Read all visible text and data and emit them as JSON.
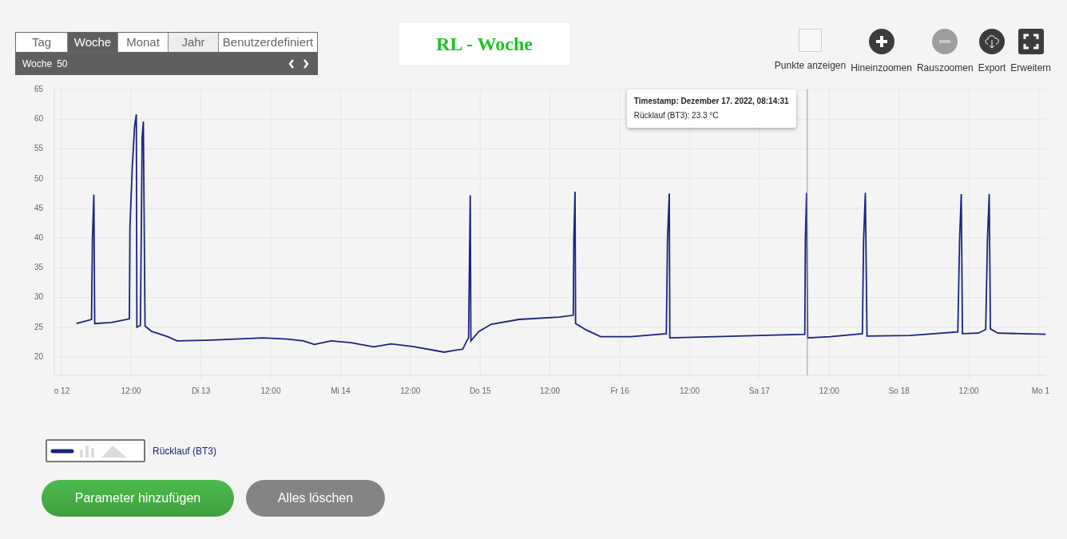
{
  "range_tabs": [
    {
      "label": "Tag",
      "selected": false,
      "hovered": false
    },
    {
      "label": "Woche",
      "selected": true,
      "hovered": false
    },
    {
      "label": "Monat",
      "selected": false,
      "hovered": false
    },
    {
      "label": "Jahr",
      "selected": false,
      "hovered": true
    },
    {
      "label": "Benutzerdefiniert",
      "selected": false,
      "hovered": false
    }
  ],
  "period": {
    "label": "Woche",
    "number": "50"
  },
  "title": "RL - Woche",
  "toolbar": [
    {
      "kind": "checkbox",
      "label": "Punkte anzeigen",
      "checked": false,
      "disabled": false
    },
    {
      "kind": "zoom_in",
      "label": "Hineinzoomen",
      "disabled": false
    },
    {
      "kind": "zoom_out",
      "label": "Rauszoomen",
      "disabled": true
    },
    {
      "kind": "export",
      "label": "Export",
      "disabled": false
    },
    {
      "kind": "expand",
      "label": "Erweitern",
      "disabled": false
    }
  ],
  "chart": {
    "chart_data": {
      "type": "line",
      "grid": true,
      "xlim": [
        "2022-12-11T22:48",
        "2022-12-19T01:18"
      ],
      "ylim": [
        16.9,
        65
      ],
      "xticks": [
        {
          "value": "2022-12-12T00:00",
          "label": "o 12"
        },
        {
          "value": "2022-12-12T12:00",
          "label": "12:00"
        },
        {
          "value": "2022-12-13T00:00",
          "label": "Di 13"
        },
        {
          "value": "2022-12-13T12:00",
          "label": "12:00"
        },
        {
          "value": "2022-12-14T00:00",
          "label": "Mi 14"
        },
        {
          "value": "2022-12-14T12:00",
          "label": "12:00"
        },
        {
          "value": "2022-12-15T00:00",
          "label": "Do 15"
        },
        {
          "value": "2022-12-15T12:00",
          "label": "12:00"
        },
        {
          "value": "2022-12-16T00:00",
          "label": "Fr 16"
        },
        {
          "value": "2022-12-16T12:00",
          "label": "12:00"
        },
        {
          "value": "2022-12-17T00:00",
          "label": "Sa 17"
        },
        {
          "value": "2022-12-17T12:00",
          "label": "12:00"
        },
        {
          "value": "2022-12-18T00:00",
          "label": "So 18"
        },
        {
          "value": "2022-12-18T12:00",
          "label": "12:00"
        },
        {
          "value": "2022-12-19T00:00",
          "label": "Mo 1"
        }
      ],
      "yticks": [
        20,
        25,
        30,
        35,
        40,
        45,
        50,
        55,
        60,
        65
      ],
      "x": [
        "2022-12-12T02:36",
        "2022-12-12T05:12",
        "2022-12-12T05:21",
        "2022-12-12T05:36",
        "2022-12-12T05:45",
        "2022-12-12T08:36",
        "2022-12-12T11:42",
        "2022-12-12T11:48",
        "2022-12-12T12:12",
        "2022-12-12T12:36",
        "2022-12-12T12:54",
        "2022-12-12T13:00",
        "2022-12-12T13:36",
        "2022-12-12T13:54",
        "2022-12-12T14:06",
        "2022-12-12T14:24",
        "2022-12-12T15:30",
        "2022-12-12T18:18",
        "2022-12-12T19:54",
        "2022-12-13T01:06",
        "2022-12-13T10:42",
        "2022-12-13T14:48",
        "2022-12-13T17:36",
        "2022-12-13T19:30",
        "2022-12-13T22:24",
        "2022-12-14T01:48",
        "2022-12-14T05:42",
        "2022-12-14T08:42",
        "2022-12-14T12:48",
        "2022-12-14T17:48",
        "2022-12-14T19:42",
        "2022-12-14T21:00",
        "2022-12-14T21:36",
        "2022-12-14T22:00",
        "2022-12-14T22:18",
        "2022-12-14T22:24",
        "2022-12-14T23:48",
        "2022-12-15T01:54",
        "2022-12-15T06:42",
        "2022-12-15T13:30",
        "2022-12-15T16:00",
        "2022-12-15T16:06",
        "2022-12-15T16:18",
        "2022-12-15T16:24",
        "2022-12-15T18:18",
        "2022-12-15T20:42",
        "2022-12-16T01:54",
        "2022-12-16T08:00",
        "2022-12-16T08:12",
        "2022-12-16T08:30",
        "2022-12-16T08:36",
        "2022-12-17T07:48",
        "2022-12-17T07:54",
        "2022-12-17T08:06",
        "2022-12-17T08:18",
        "2022-12-17T12:12",
        "2022-12-17T17:42",
        "2022-12-17T17:54",
        "2022-12-17T18:12",
        "2022-12-17T18:30",
        "2022-12-18T01:54",
        "2022-12-18T10:06",
        "2022-12-18T10:24",
        "2022-12-18T10:42",
        "2022-12-18T10:54",
        "2022-12-18T13:36",
        "2022-12-18T14:54",
        "2022-12-18T15:12",
        "2022-12-18T15:30",
        "2022-12-18T15:42",
        "2022-12-18T17:00",
        "2022-12-19T01:12"
      ],
      "series": [
        {
          "name": "Rücklauf (BT3)",
          "color": "#1a237e",
          "values": [
            25.6,
            26.3,
            39.7,
            47.3,
            25.6,
            25.8,
            26.4,
            41.8,
            51.8,
            58.8,
            60.8,
            25.0,
            25.3,
            57,
            59.6,
            25.2,
            24.3,
            23.4,
            22.7,
            22.8,
            23.2,
            23.0,
            22.7,
            22.1,
            22.7,
            22.4,
            21.7,
            22.2,
            21.7,
            20.8,
            21.1,
            21.3,
            22.5,
            23.2,
            47.2,
            22.7,
            24.3,
            25.5,
            26.3,
            26.7,
            27.0,
            39.7,
            47.8,
            25.6,
            24.5,
            23.4,
            23.4,
            23.9,
            39.7,
            47.5,
            23.2,
            23.8,
            39.7,
            47.6,
            23.2,
            23.4,
            23.9,
            39.7,
            47.6,
            23.5,
            23.6,
            24.2,
            39.7,
            47.4,
            23.9,
            24.0,
            24.6,
            39.7,
            47.4,
            24.7,
            24.0,
            23.8
          ]
        }
      ],
      "ref_lines": [
        {
          "axis": "x",
          "value": "2022-12-17T08:14"
        }
      ]
    },
    "tooltip": {
      "title": "Timestamp: Dezember 17. 2022, 08:14:31",
      "text": "Rücklauf (BT3): 23.3 °C"
    }
  },
  "legend": {
    "styles": [
      {
        "kind": "line",
        "selected": true
      },
      {
        "kind": "bars",
        "selected": false
      },
      {
        "kind": "area",
        "selected": false
      }
    ]
  },
  "buttons": [
    {
      "kind": "primary",
      "label": "Parameter hinzufügen"
    },
    {
      "kind": "secondary",
      "label": "Alles löschen"
    }
  ]
}
